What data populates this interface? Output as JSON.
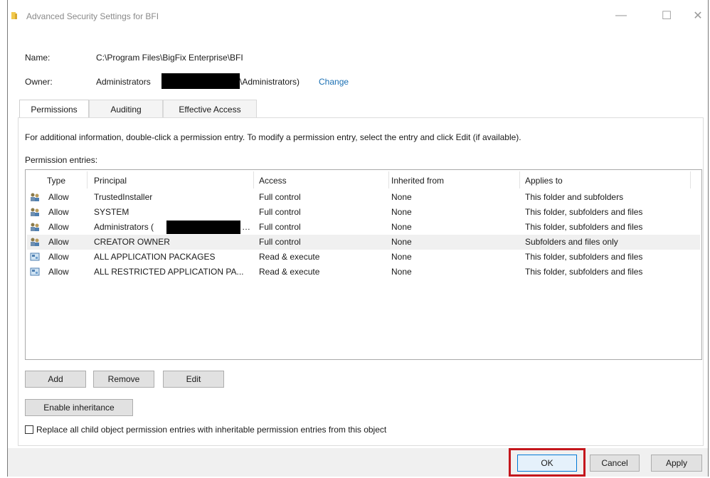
{
  "window": {
    "title": "Advanced Security Settings for BFI",
    "minimize_glyph": "—",
    "maximize_glyph": "☐",
    "close_glyph": "✕"
  },
  "details": {
    "name_label": "Name:",
    "name_value": "C:\\Program Files\\BigFix Enterprise\\BFI",
    "owner_label": "Owner:",
    "owner_value_prefix": "Administrators",
    "owner_value_suffix": "\\Administrators)",
    "change_link": "Change"
  },
  "tabs": [
    {
      "label": "Permissions",
      "active": true
    },
    {
      "label": "Auditing",
      "active": false
    },
    {
      "label": "Effective Access",
      "active": false
    }
  ],
  "info_text": "For additional information, double-click a permission entry. To modify a permission entry, select the entry and click Edit (if available).",
  "permission_entries_label": "Permission entries:",
  "table": {
    "columns": [
      "Type",
      "Principal",
      "Access",
      "Inherited from",
      "Applies to"
    ],
    "rows": [
      {
        "icon": "users-icon",
        "type": "Allow",
        "principal": "TrustedInstaller",
        "access": "Full control",
        "inherited": "None",
        "applies": "This folder and subfolders"
      },
      {
        "icon": "users-icon",
        "type": "Allow",
        "principal": "SYSTEM",
        "access": "Full control",
        "inherited": "None",
        "applies": "This folder, subfolders and files"
      },
      {
        "icon": "users-icon",
        "type": "Allow",
        "principal": "Administrators (",
        "access": "Full control",
        "inherited": "None",
        "applies": "This folder, subfolders and files"
      },
      {
        "icon": "users-icon",
        "type": "Allow",
        "principal": "CREATOR OWNER",
        "access": "Full control",
        "inherited": "None",
        "applies": "Subfolders and files only"
      },
      {
        "icon": "app-package-icon",
        "type": "Allow",
        "principal": "ALL APPLICATION PACKAGES",
        "access": "Read & execute",
        "inherited": "None",
        "applies": "This folder, subfolders and files"
      },
      {
        "icon": "app-package-icon",
        "type": "Allow",
        "principal": "ALL RESTRICTED APPLICATION PA...",
        "access": "Read & execute",
        "inherited": "None",
        "applies": "This folder, subfolders and files"
      }
    ]
  },
  "buttons": {
    "add": "Add",
    "remove": "Remove",
    "edit": "Edit",
    "enable_inheritance": "Enable inheritance",
    "ok": "OK",
    "cancel": "Cancel",
    "apply": "Apply"
  },
  "checkbox": {
    "label": "Replace all child object permission entries with inheritable permission entries from this object",
    "checked": false
  },
  "colors": {
    "link": "#1a6fb3",
    "highlight": "#c4161c",
    "title_icon": "#f2c94c"
  }
}
